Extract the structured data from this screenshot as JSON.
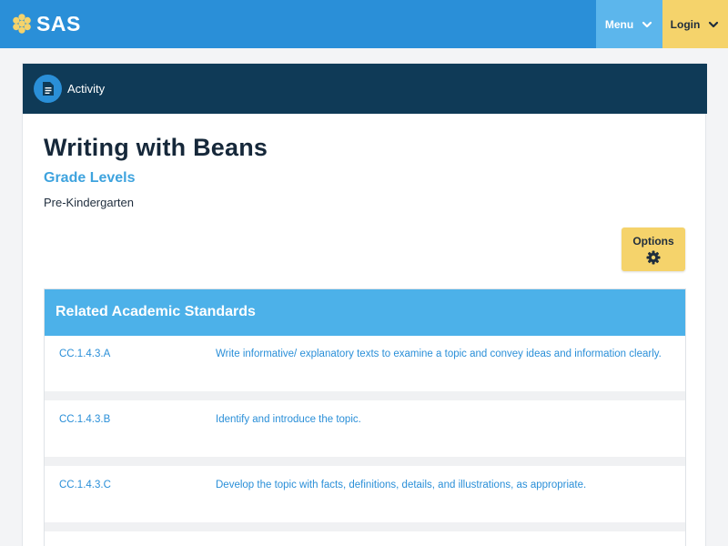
{
  "header": {
    "logo_text": "SAS",
    "menu_label": "Menu",
    "login_label": "Login",
    "colors": {
      "bar": "#2a8fd8",
      "menu": "#5cb6ec",
      "login": "#f5d36b"
    }
  },
  "card": {
    "type_label": "Activity",
    "title": "Writing with Beans",
    "grade_heading": "Grade Levels",
    "grade_value": "Pre-Kindergarten",
    "options_label": "Options"
  },
  "standards": {
    "heading": "Related Academic Standards",
    "rows": [
      {
        "code": "CC.1.4.3.A",
        "description": "Write informative/ explanatory texts to examine a topic and convey ideas and information clearly."
      },
      {
        "code": "CC.1.4.3.B",
        "description": "Identify and introduce the topic."
      },
      {
        "code": "CC.1.4.3.C",
        "description": "Develop the topic with facts, definitions, details, and illustrations, as appropriate."
      }
    ]
  },
  "icons": [
    "flower-logo-icon",
    "chevron-down-icon",
    "document-icon",
    "gear-icon"
  ]
}
